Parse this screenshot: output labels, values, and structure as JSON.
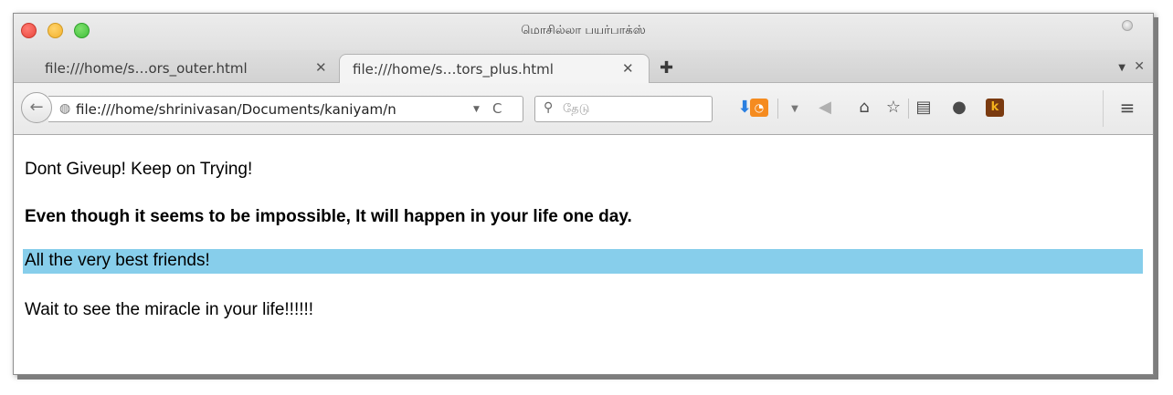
{
  "window": {
    "title": "மொசில்லா பயர்பாக்ஸ்"
  },
  "tabs": [
    {
      "label": "file:///home/s…ors_outer.html",
      "close": "✕",
      "active": false
    },
    {
      "label": "file:///home/s…tors_plus.html",
      "close": "✕",
      "active": true
    }
  ],
  "tabstrip": {
    "new_tab": "✚",
    "list_arrow": "▼",
    "close": "✕"
  },
  "toolbar": {
    "back_icon": "arrow-left",
    "url": "file:///home/shrinivasan/Documents/kaniyam/n",
    "url_dropdown": "▼",
    "reload_glyph": "C",
    "search_placeholder": "தேடு",
    "icons": [
      "download",
      "rss-feed",
      "send",
      "home",
      "bookmark-star",
      "reading-list",
      "chat",
      "k-extension",
      "menu"
    ]
  },
  "content": {
    "line1": "Dont Giveup! Keep on Trying!",
    "line2": "Even though it seems to be impossible, It will happen in your life one day.",
    "line3": "All the very best friends!",
    "line4": "Wait to see the miracle in your life!!!!!!"
  },
  "colors": {
    "highlight": "#87ceeb",
    "close_light": "#e8463b",
    "minimize_light": "#f3b12c",
    "maximize_light": "#3fbf3a",
    "download_icon": "#2a7fe0",
    "rss_icon": "#f58b1f"
  }
}
